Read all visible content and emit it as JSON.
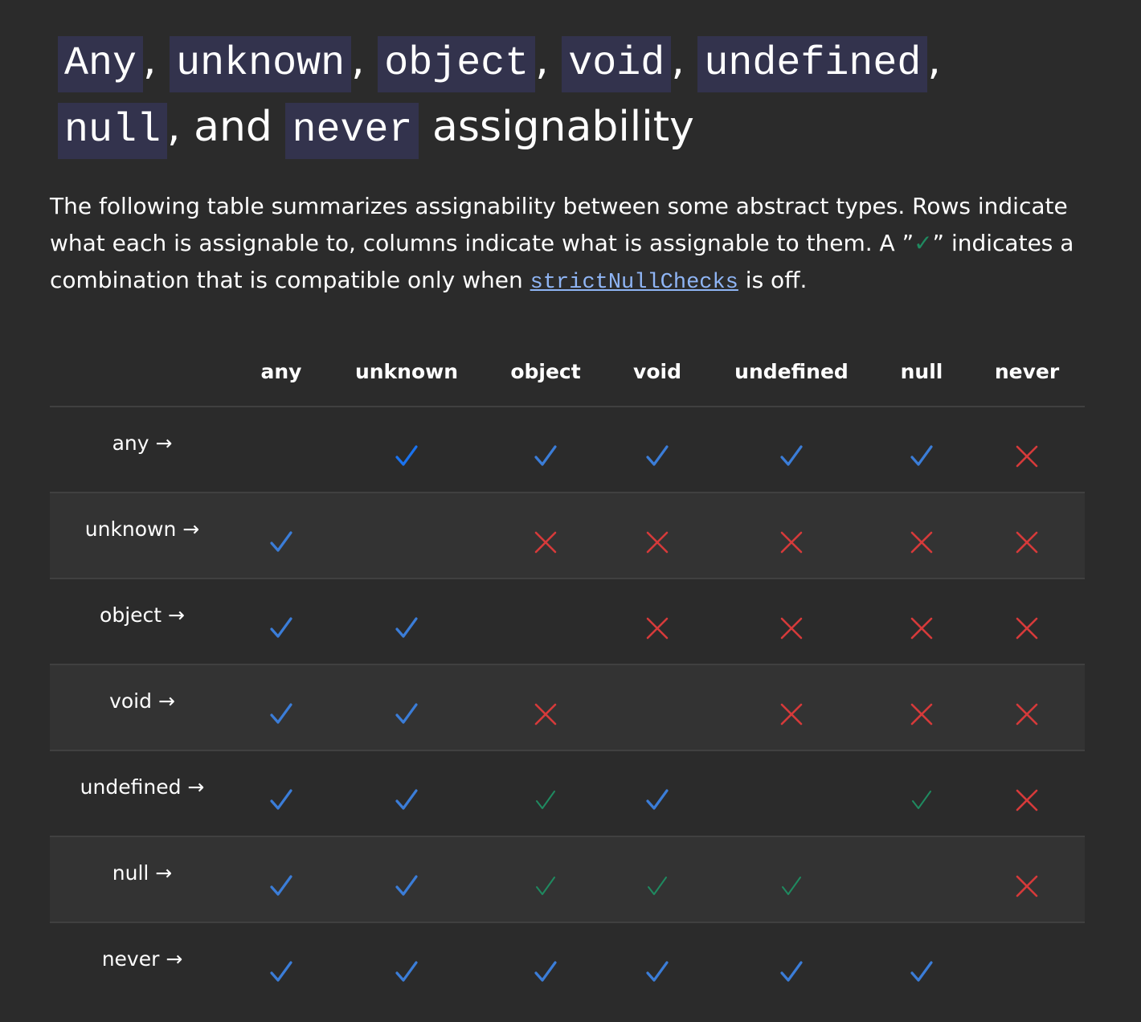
{
  "title": {
    "parts": [
      "Any",
      "unknown",
      "object",
      "void",
      "undefined",
      "null",
      "never"
    ],
    "separator": ",",
    "and_text": ", and",
    "suffix": "assignability"
  },
  "intro": {
    "text_before_check": "The following table summarizes assignability between some abstract types. Rows indicate what each is assignable to, columns indicate what is assignable to them. A ”",
    "check_symbol": "✓",
    "text_after_check": "” indicates a combination that is compatible only when ",
    "link_text": "strictNullChecks",
    "text_end": " is off."
  },
  "table": {
    "columns": [
      "any",
      "unknown",
      "object",
      "void",
      "undefined",
      "null",
      "never"
    ],
    "rows": [
      {
        "label": "any →",
        "cells": [
          "",
          "check-bright",
          "check",
          "check",
          "check",
          "check",
          "cross"
        ]
      },
      {
        "label": "unknown →",
        "cells": [
          "check",
          "",
          "cross",
          "cross",
          "cross",
          "cross",
          "cross"
        ]
      },
      {
        "label": "object →",
        "cells": [
          "check",
          "check",
          "",
          "cross",
          "cross",
          "cross",
          "cross"
        ]
      },
      {
        "label": "void →",
        "cells": [
          "check",
          "check",
          "cross",
          "",
          "cross",
          "cross",
          "cross"
        ]
      },
      {
        "label": "undefined →",
        "cells": [
          "check",
          "check",
          "check-green",
          "check",
          "",
          "check-green",
          "cross"
        ]
      },
      {
        "label": "null →",
        "cells": [
          "check",
          "check",
          "check-green",
          "check-green",
          "check-green",
          "",
          "cross"
        ]
      },
      {
        "label": "never →",
        "cells": [
          "check",
          "check",
          "check",
          "check",
          "check",
          "check",
          ""
        ]
      }
    ]
  },
  "colors": {
    "background": "#2b2b2b",
    "row_alt": "#333333",
    "code_bg": "#33334d",
    "check": "#3b7dd8",
    "check_bright": "#1a73f0",
    "check_green": "#1f8a60",
    "cross": "#d63a3a",
    "link": "#8fb5f5"
  },
  "icons": {
    "check": "check-icon",
    "cross": "cross-icon",
    "arrow": "right-arrow"
  }
}
